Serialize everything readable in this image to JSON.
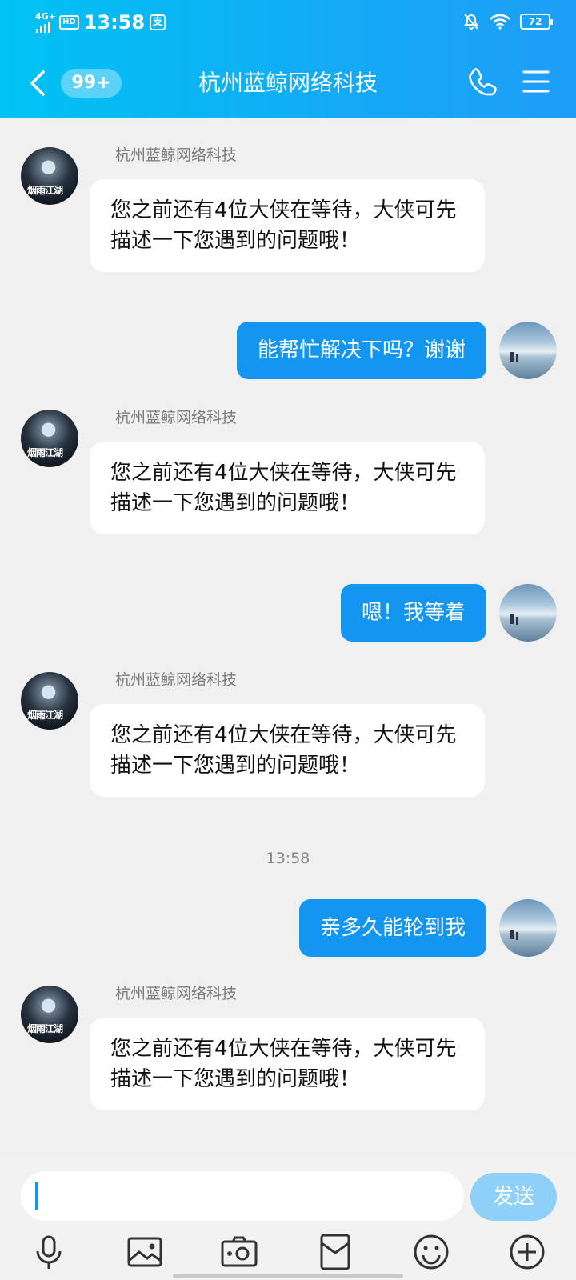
{
  "status_bar": {
    "network": "4G+",
    "hd": "HD",
    "time": "13:58",
    "alipay": "支",
    "battery": "72"
  },
  "header": {
    "unread_badge": "99+",
    "title": "杭州蓝鲸网络科技",
    "icons": [
      "back-icon",
      "phone-icon",
      "menu-icon"
    ],
    "background": "#14aaf5"
  },
  "conversation": {
    "agent_name": "杭州蓝鲸网络科技",
    "agent_avatar_text": "烟雨江湖",
    "agent_message": "您之前还有4位大侠在等待，大侠可先描述一下您遇到的问题哦！",
    "timestamp": "13:58",
    "user_messages": [
      "能帮忙解决下吗？谢谢",
      "嗯！我等着",
      "亲多久能轮到我"
    ]
  },
  "input_bar": {
    "send_label": "发送",
    "accent": "#1296f0",
    "tool_icons": [
      "microphone-icon",
      "image-icon",
      "camera-icon",
      "red-packet-icon",
      "emoji-icon",
      "plus-icon"
    ]
  }
}
